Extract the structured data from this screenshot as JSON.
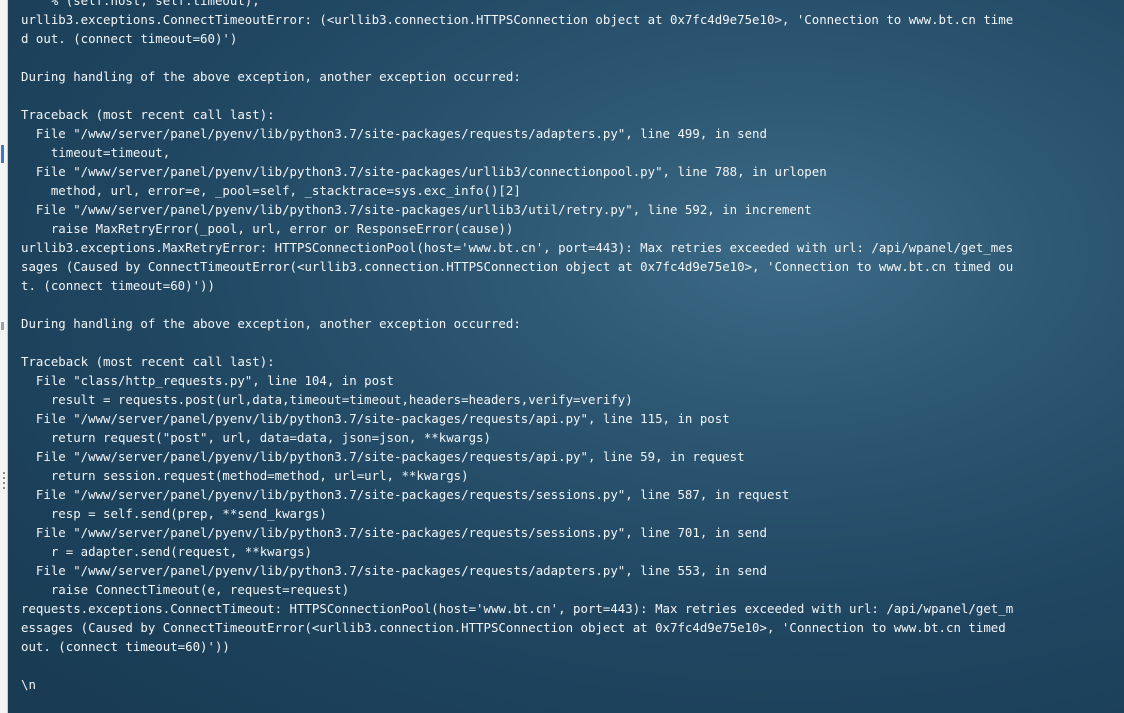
{
  "terminal": {
    "lines": [
      "    % (self.host, self.timeout),",
      "urllib3.exceptions.ConnectTimeoutError: (<urllib3.connection.HTTPSConnection object at 0x7fc4d9e75e10>, 'Connection to www.bt.cn time",
      "d out. (connect timeout=60)')",
      "",
      "During handling of the above exception, another exception occurred:",
      "",
      "Traceback (most recent call last):",
      "  File \"/www/server/panel/pyenv/lib/python3.7/site-packages/requests/adapters.py\", line 499, in send",
      "    timeout=timeout,",
      "  File \"/www/server/panel/pyenv/lib/python3.7/site-packages/urllib3/connectionpool.py\", line 788, in urlopen",
      "    method, url, error=e, _pool=self, _stacktrace=sys.exc_info()[2]",
      "  File \"/www/server/panel/pyenv/lib/python3.7/site-packages/urllib3/util/retry.py\", line 592, in increment",
      "    raise MaxRetryError(_pool, url, error or ResponseError(cause))",
      "urllib3.exceptions.MaxRetryError: HTTPSConnectionPool(host='www.bt.cn', port=443): Max retries exceeded with url: /api/wpanel/get_mes",
      "sages (Caused by ConnectTimeoutError(<urllib3.connection.HTTPSConnection object at 0x7fc4d9e75e10>, 'Connection to www.bt.cn timed ou",
      "t. (connect timeout=60)'))",
      "",
      "During handling of the above exception, another exception occurred:",
      "",
      "Traceback (most recent call last):",
      "  File \"class/http_requests.py\", line 104, in post",
      "    result = requests.post(url,data,timeout=timeout,headers=headers,verify=verify)",
      "  File \"/www/server/panel/pyenv/lib/python3.7/site-packages/requests/api.py\", line 115, in post",
      "    return request(\"post\", url, data=data, json=json, **kwargs)",
      "  File \"/www/server/panel/pyenv/lib/python3.7/site-packages/requests/api.py\", line 59, in request",
      "    return session.request(method=method, url=url, **kwargs)",
      "  File \"/www/server/panel/pyenv/lib/python3.7/site-packages/requests/sessions.py\", line 587, in request",
      "    resp = self.send(prep, **send_kwargs)",
      "  File \"/www/server/panel/pyenv/lib/python3.7/site-packages/requests/sessions.py\", line 701, in send",
      "    r = adapter.send(request, **kwargs)",
      "  File \"/www/server/panel/pyenv/lib/python3.7/site-packages/requests/adapters.py\", line 553, in send",
      "    raise ConnectTimeout(e, request=request)",
      "requests.exceptions.ConnectTimeout: HTTPSConnectionPool(host='www.bt.cn', port=443): Max retries exceeded with url: /api/wpanel/get_m",
      "essages (Caused by ConnectTimeoutError(<urllib3.connection.HTTPSConnection object at 0x7fc4d9e75e10>, 'Connection to www.bt.cn timed",
      "out. (connect timeout=60)'))",
      "",
      "\\n"
    ]
  },
  "colors": {
    "text": "#f2f5f7",
    "background_center": "#3c6a86",
    "background_edge": "#183a52"
  }
}
